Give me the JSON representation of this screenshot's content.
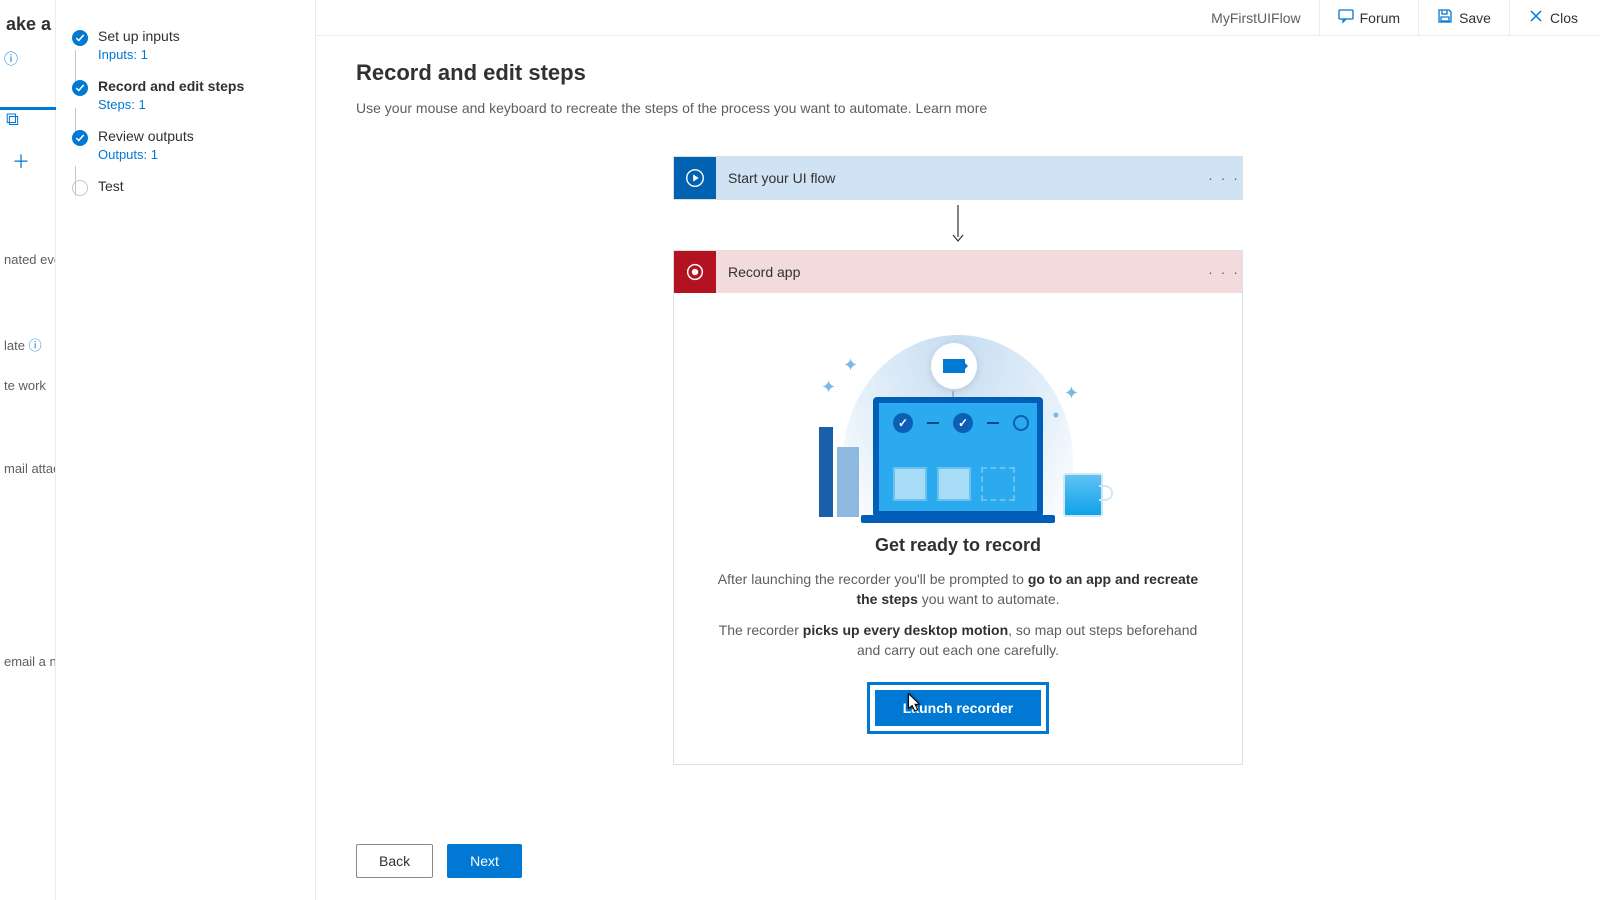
{
  "far_left": {
    "heading": "ake a flo",
    "truncs": [
      "nated even",
      "late",
      "te work",
      "mail attac",
      "email a n"
    ]
  },
  "wizard": {
    "steps": [
      {
        "label": "Set up inputs",
        "sub": "Inputs: 1",
        "state": "done"
      },
      {
        "label": "Record and edit steps",
        "sub": "Steps: 1",
        "state": "done",
        "current": true
      },
      {
        "label": "Review outputs",
        "sub": "Outputs: 1",
        "state": "done"
      },
      {
        "label": "Test",
        "sub": "",
        "state": "pending"
      }
    ]
  },
  "topbar": {
    "flowname": "MyFirstUIFlow",
    "forum": "Forum",
    "save": "Save",
    "close": "Clos"
  },
  "main": {
    "title": "Record and edit steps",
    "desc": "Use your mouse and keyboard to recreate the steps of the process you want to automate.  ",
    "learn": "Learn more"
  },
  "cards": {
    "start": "Start your UI flow",
    "record": "Record app",
    "more": "· · ·"
  },
  "body": {
    "heading": "Get ready to record",
    "p1a": "After launching the recorder you'll be prompted to ",
    "p1b": "go to an app and recreate the steps",
    "p1c": " you want to automate.",
    "p2a": "The recorder ",
    "p2b": "picks up every desktop motion",
    "p2c": ", so map out steps beforehand and carry out each one carefully.",
    "launch": "Launch recorder"
  },
  "footer": {
    "back": "Back",
    "next": "Next"
  }
}
